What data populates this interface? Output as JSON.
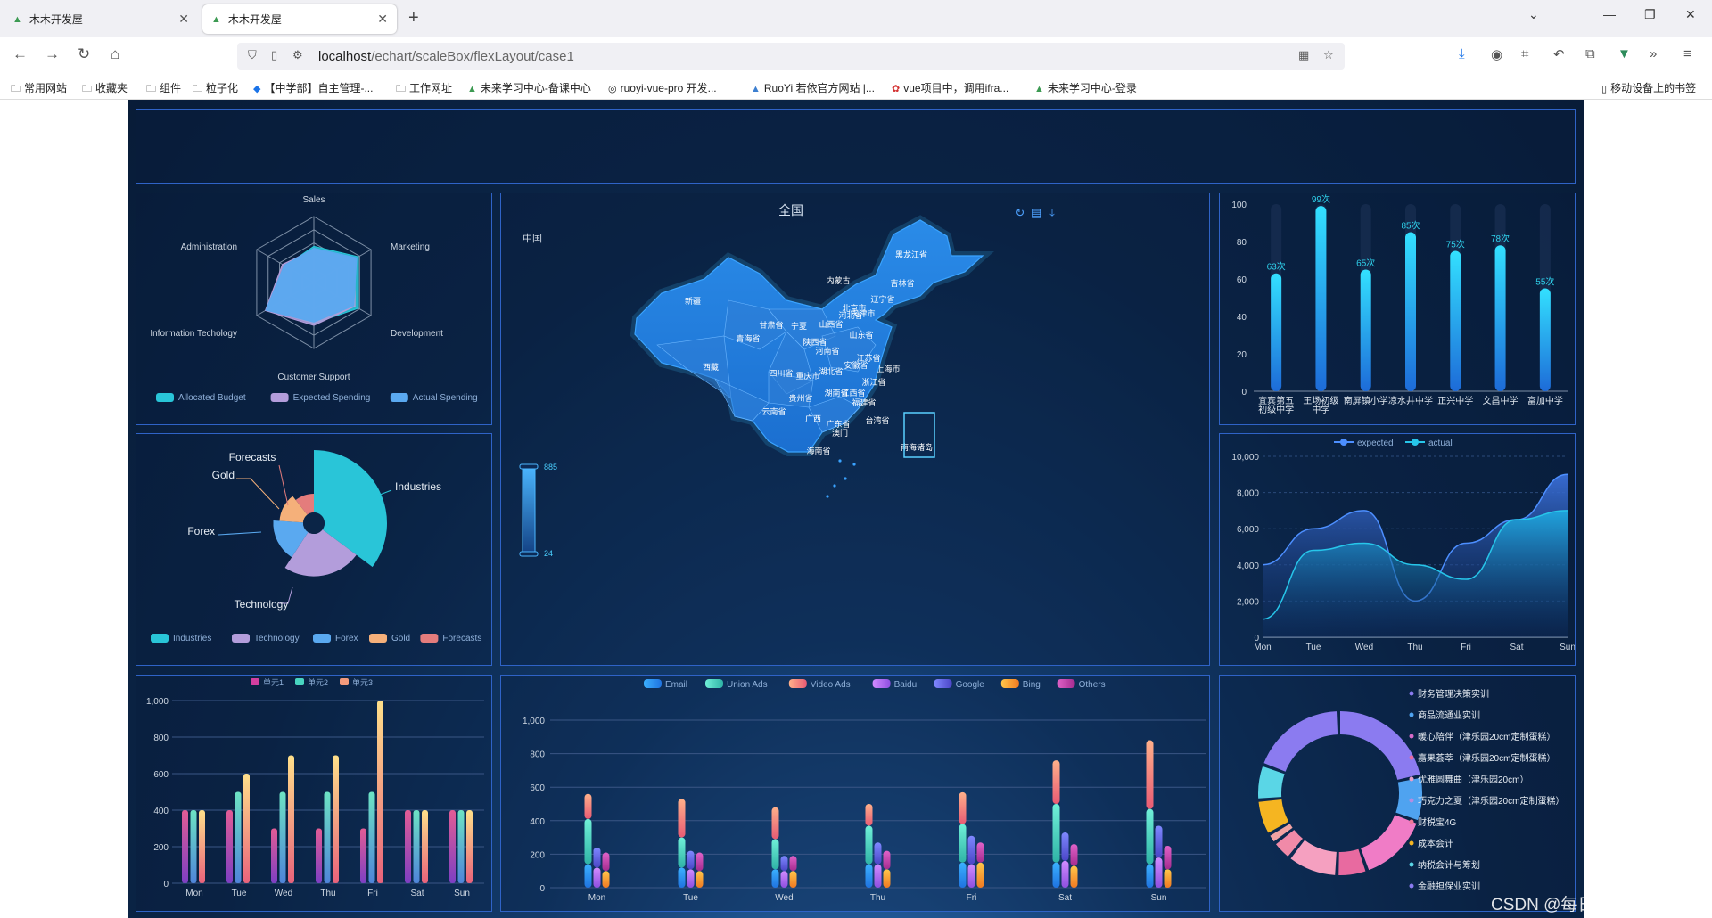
{
  "browser": {
    "tabs": [
      {
        "title": "木木开发屋"
      },
      {
        "title": "木木开发屋"
      }
    ],
    "url_host": "localhost",
    "url_path": "/echart/scaleBox/flexLayout/case1",
    "bookmarks": [
      "常用网站",
      "收藏夹",
      "组件",
      "粒子化",
      "【中学部】自主管理-...",
      "工作网址",
      "未来学习中心-备课中心",
      "ruoyi-vue-pro 开发...",
      "RuoYi 若依官方网站 |...",
      "vue项目中，调用ifra...",
      "未来学习中心-登录"
    ],
    "mobile_bookmarks": "移动设备上的书签"
  },
  "watermark": "CSDN @每日一问终成大佬",
  "map": {
    "title": "全国",
    "subtitle": "中国",
    "visualmap_max": "885",
    "visualmap_min": "24",
    "regions": [
      "新疆",
      "西藏",
      "青海省",
      "甘肃省",
      "内蒙古",
      "黑龙江省",
      "吉林省",
      "辽宁省",
      "北京市",
      "天津市",
      "河北省",
      "山西省",
      "宁夏",
      "陕西省",
      "山东省",
      "河南省",
      "江苏省",
      "安徽省",
      "上海市",
      "湖北省",
      "浙江省",
      "四川省",
      "重庆市",
      "湖南省",
      "江西省",
      "福建省",
      "贵州省",
      "云南省",
      "广西",
      "广东省",
      "澳门",
      "台湾省",
      "海南省",
      "南海诸岛"
    ]
  },
  "colors": {
    "frame": "#2f63c7",
    "cyan": "#29c5d8",
    "purple": "#b39ddb",
    "blue": "#5aa9f0",
    "orange": "#f5b07a",
    "red": "#e47c7c"
  },
  "chart_data": [
    {
      "type": "radar",
      "indicators": [
        "Sales",
        "Marketing",
        "Development",
        "Customer Support",
        "Information Techology",
        "Administration"
      ],
      "series": [
        {
          "name": "Allocated Budget",
          "values": [
            0.55,
            0.78,
            0.78,
            0.62,
            0.82,
            0.5
          ]
        },
        {
          "name": "Expected Spending",
          "values": [
            0.5,
            0.72,
            0.72,
            0.65,
            0.85,
            0.55
          ]
        },
        {
          "name": "Actual Spending",
          "values": [
            0.52,
            0.75,
            0.7,
            0.6,
            0.84,
            0.52
          ]
        }
      ]
    },
    {
      "type": "pie",
      "rose": true,
      "categories": [
        "Industries",
        "Technology",
        "Forex",
        "Gold",
        "Forecasts"
      ],
      "values": [
        100,
        68,
        48,
        38,
        30
      ]
    },
    {
      "type": "bar",
      "categories": [
        "宜宾第五初级中学",
        "王场初级中学",
        "南屏镇小学",
        "凉水井中学",
        "正兴中学",
        "文昌中学",
        "富加中学"
      ],
      "values": [
        63,
        99,
        65,
        85,
        75,
        78,
        55
      ],
      "value_suffix": "次",
      "ylim": [
        0,
        100
      ],
      "yticks": [
        0,
        20,
        40,
        60,
        80,
        100
      ]
    },
    {
      "type": "area",
      "categories": [
        "Mon",
        "Tue",
        "Wed",
        "Thu",
        "Fri",
        "Sat",
        "Sun"
      ],
      "series": [
        {
          "name": "expected",
          "values": [
            4000,
            6000,
            7000,
            2000,
            5200,
            6500,
            9000
          ]
        },
        {
          "name": "actual",
          "values": [
            1000,
            4800,
            5200,
            4000,
            3200,
            6500,
            7000
          ]
        }
      ],
      "ylim": [
        0,
        10000
      ],
      "yticks": [
        "0",
        "2,000",
        "4,000",
        "6,000",
        "8,000",
        "10,000"
      ]
    },
    {
      "type": "bar",
      "categories": [
        "Mon",
        "Tue",
        "Wed",
        "Thu",
        "Fri",
        "Sat",
        "Sun"
      ],
      "series": [
        {
          "name": "单元1",
          "values": [
            400,
            400,
            300,
            300,
            300,
            400,
            400
          ]
        },
        {
          "name": "单元2",
          "values": [
            400,
            500,
            500,
            500,
            500,
            400,
            400
          ]
        },
        {
          "name": "单元3",
          "values": [
            400,
            600,
            700,
            700,
            1000,
            400,
            400
          ]
        }
      ],
      "ylim": [
        0,
        1000
      ],
      "yticks": [
        "0",
        "200",
        "400",
        "600",
        "800",
        "1,000"
      ]
    },
    {
      "type": "bar",
      "stacked": true,
      "categories": [
        "Mon",
        "Tue",
        "Wed",
        "Thu",
        "Fri",
        "Sat",
        "Sun"
      ],
      "series": [
        {
          "name": "Email",
          "values": [
            140,
            120,
            110,
            140,
            150,
            150,
            140
          ]
        },
        {
          "name": "Union Ads",
          "values": [
            270,
            180,
            180,
            230,
            230,
            350,
            330
          ]
        },
        {
          "name": "Video Ads",
          "values": [
            150,
            230,
            190,
            130,
            190,
            260,
            410
          ]
        },
        {
          "name": "Baidu",
          "values": [
            120,
            110,
            100,
            140,
            140,
            160,
            180
          ]
        },
        {
          "name": "Google",
          "values": [
            120,
            110,
            90,
            130,
            170,
            170,
            190
          ]
        },
        {
          "name": "Bing",
          "values": [
            100,
            100,
            100,
            110,
            150,
            130,
            110
          ]
        },
        {
          "name": "Others",
          "values": [
            110,
            110,
            90,
            110,
            120,
            130,
            140
          ]
        }
      ],
      "ylim": [
        0,
        1000
      ],
      "yticks": [
        "0",
        "200",
        "400",
        "600",
        "800",
        "1,000"
      ]
    },
    {
      "type": "pie",
      "donut": true,
      "categories": [
        "财务管理决策实训",
        "商品流通业实训",
        "暖心陪伴（津乐园20cm定制蛋糕）",
        "嘉果荟萃（津乐园20cm定制蛋糕）",
        "优雅圆舞曲（津乐园20cm）",
        "巧克力之夏（津乐园20cm定制蛋糕）",
        "财税宝4G",
        "成本会计",
        "纳税会计与筹划",
        "金融担保业实训"
      ],
      "values": [
        22,
        9,
        14,
        6,
        10,
        4,
        2,
        7,
        7,
        19
      ]
    }
  ]
}
